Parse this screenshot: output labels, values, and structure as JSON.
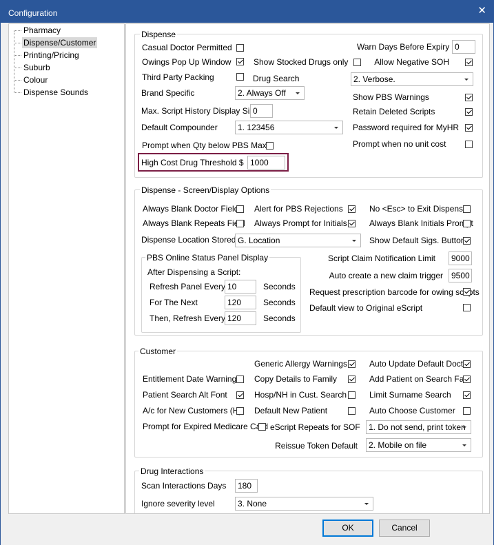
{
  "window": {
    "title": "Configuration"
  },
  "tree": {
    "items": [
      {
        "label": "Pharmacy",
        "selected": false
      },
      {
        "label": "Dispense/Customer",
        "selected": true
      },
      {
        "label": "Printing/Pricing",
        "selected": false
      },
      {
        "label": "Suburb",
        "selected": false
      },
      {
        "label": "Colour",
        "selected": false
      },
      {
        "label": "Dispense Sounds",
        "selected": false
      }
    ]
  },
  "dispense": {
    "title": "Dispense",
    "casual_doctor": {
      "label": "Casual Doctor Permitted",
      "checked": false
    },
    "owings_popup": {
      "label": "Owings Pop Up Window",
      "checked": true
    },
    "show_stocked": {
      "label": "Show Stocked Drugs only",
      "checked": false
    },
    "third_party": {
      "label": "Third Party Packing",
      "checked": false
    },
    "drug_search": {
      "label": "Drug Search",
      "value": "2. Verbose."
    },
    "brand_specific": {
      "label": "Brand Specific",
      "value": "2. Always Off"
    },
    "max_script": {
      "label": "Max. Script History Display Size",
      "value": "0"
    },
    "default_compounder": {
      "label": "Default Compounder",
      "value": "1. 123456"
    },
    "prompt_qty": {
      "label": "Prompt when Qty below PBS Max",
      "checked": false
    },
    "high_cost": {
      "label": "High Cost Drug Threshold $",
      "value": "1000"
    },
    "warn_days": {
      "label": "Warn Days Before Expiry",
      "value": "0"
    },
    "allow_negative": {
      "label": "Allow Negative SOH",
      "checked": true
    },
    "show_pbs": {
      "label": "Show PBS Warnings",
      "checked": true
    },
    "retain_deleted": {
      "label": "Retain Deleted Scripts",
      "checked": true
    },
    "password_myhr": {
      "label": "Password required for MyHR",
      "checked": true
    },
    "prompt_unit_cost": {
      "label": "Prompt when no unit cost",
      "checked": false
    }
  },
  "screen": {
    "title": "Dispense - Screen/Display Options",
    "blank_doctor": {
      "label": "Always Blank Doctor Field",
      "checked": false
    },
    "alert_pbs": {
      "label": "Alert for PBS Rejections",
      "checked": true
    },
    "no_esc": {
      "label": "No <Esc> to Exit Dispense",
      "checked": false
    },
    "blank_repeats": {
      "label": "Always Blank Repeats Field",
      "checked": false
    },
    "prompt_initials": {
      "label": "Always Prompt for Initials",
      "checked": true
    },
    "blank_initials": {
      "label": "Always Blank Initials Prompt",
      "checked": false
    },
    "location_stored": {
      "label": "Dispense Location Stored",
      "value": "G. Location"
    },
    "show_sigs": {
      "label": "Show Default Sigs. Button",
      "checked": true
    },
    "pbs_panel": {
      "title": "PBS Online Status Panel Display",
      "after": "After Dispensing a Script:",
      "rows": [
        {
          "label": "Refresh Panel Every",
          "value": "10",
          "unit": "Seconds"
        },
        {
          "label": "For The Next",
          "value": "120",
          "unit": "Seconds"
        },
        {
          "label": "Then, Refresh Every",
          "value": "120",
          "unit": "Seconds"
        }
      ]
    },
    "claim_limit": {
      "label": "Script Claim Notification Limit",
      "value": "9000"
    },
    "claim_trigger": {
      "label": "Auto create a new claim trigger",
      "value": "9500"
    },
    "request_barcode": {
      "label": "Request prescription barcode for owing scripts",
      "checked": true
    },
    "default_escript": {
      "label": "Default view to Original eScript",
      "checked": false
    }
  },
  "customer": {
    "title": "Customer",
    "generic_allergy": {
      "label": "Generic Allergy Warnings",
      "checked": true
    },
    "auto_update_doctor": {
      "label": "Auto Update Default Doct...",
      "checked": true
    },
    "entitlement": {
      "label": "Entitlement Date Warnings",
      "checked": false
    },
    "copy_details": {
      "label": "Copy Details to Family",
      "checked": true
    },
    "add_patient": {
      "label": "Add Patient on Search Fail",
      "checked": true
    },
    "alt_font": {
      "label": "Patient Search Alt Font",
      "checked": true
    },
    "hosp_nh": {
      "label": "Hosp/NH in Cust. Search",
      "checked": false
    },
    "limit_surname": {
      "label": "Limit Surname Search",
      "checked": true
    },
    "ac_new": {
      "label": "A/c for New Customers (H)",
      "checked": false
    },
    "default_new_patient": {
      "label": "Default New Patient",
      "checked": false
    },
    "auto_choose": {
      "label": "Auto Choose Customer",
      "checked": false
    },
    "prompt_medicare": {
      "label": "Prompt for Expired Medicare Card",
      "checked": false
    },
    "escript_repeats": {
      "label": "eScript Repeats for SOF",
      "value": "1. Do not send, print token"
    },
    "reissue_token": {
      "label": "Reissue Token Default",
      "value": "2. Mobile on file"
    }
  },
  "interactions": {
    "title": "Drug Interactions",
    "scan_days": {
      "label": "Scan Interactions Days",
      "value": "180"
    },
    "ignore_severity": {
      "label": "Ignore severity level",
      "value": "3. None"
    }
  },
  "buttons": {
    "ok": "OK",
    "cancel": "Cancel"
  }
}
